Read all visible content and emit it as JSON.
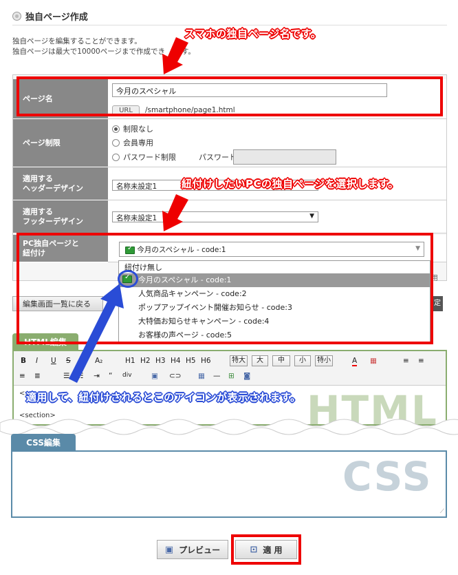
{
  "header": {
    "title": "独自ページ作成"
  },
  "description": {
    "line1": "独自ページを編集することができます。",
    "line2": "独自ページは最大で10000ページまで作成でき",
    "line2_end": "す。"
  },
  "form": {
    "page_name": {
      "label": "ページ名",
      "value": "今月のスペシャル",
      "url_tag": "URL",
      "url": "/smartphone/page1.html"
    },
    "page_limit": {
      "label": "ページ制限",
      "options": [
        "制限なし",
        "会員専用",
        "パスワード制限"
      ],
      "password_label": "パスワード："
    },
    "header_design": {
      "label_1": "適用する",
      "label_2": "ヘッダーデザイン",
      "value": "名称未設定1"
    },
    "footer_design": {
      "label_1": "適用する",
      "label_2": "フッターデザイン",
      "value": "名称未設定1"
    },
    "pc_link": {
      "label_1": "PC独自ページと",
      "label_2": "紐付け",
      "value": "今月のスペシャル - code:1"
    }
  },
  "dropdown": {
    "items": [
      "紐付け無し",
      "今月のスペシャル - code:1",
      "人気商品キャンペーン - code:2",
      "ポップアップイベント開催お知らせ - code:3",
      "大特価お知らせキャンペーン - code:4",
      "お客様の声ページ - code:5"
    ]
  },
  "nav": {
    "back_label": "編集画面一覧に戻る",
    "side_right": "用"
  },
  "html_editor": {
    "tab": "HTML編集",
    "watermark": "HTML",
    "toolbar": {
      "bold": "B",
      "italic": "I",
      "underline": "U",
      "strike": "S",
      "size": "A₂",
      "h1": "H1",
      "h2": "H2",
      "h3": "H3",
      "h4": "H4",
      "h5": "H5",
      "h6": "H6",
      "large_xl": "特大",
      "large": "大",
      "medium": "中",
      "small": "小",
      "small_xs": "特小",
      "color": "A",
      "quote": "“",
      "div": "div"
    },
    "code_line1": "<s",
    "code_line2": "<section>"
  },
  "css_editor": {
    "tab": "CSS編集",
    "watermark": "CSS"
  },
  "buttons": {
    "preview": "プレビュー",
    "apply": "適 用"
  },
  "annotations": {
    "a1": "スマホの独自ページ名です。",
    "a2": "紐付けしたいPCの独自ページを選択します。",
    "a3": "適用して、紐付けされるとこのアイコンが表示されます。"
  },
  "colors": {
    "annotation_red": "#e00000",
    "annotation_blue": "#2a4cd6",
    "html_tab": "#8aad6f",
    "css_tab": "#5a8aa8"
  }
}
